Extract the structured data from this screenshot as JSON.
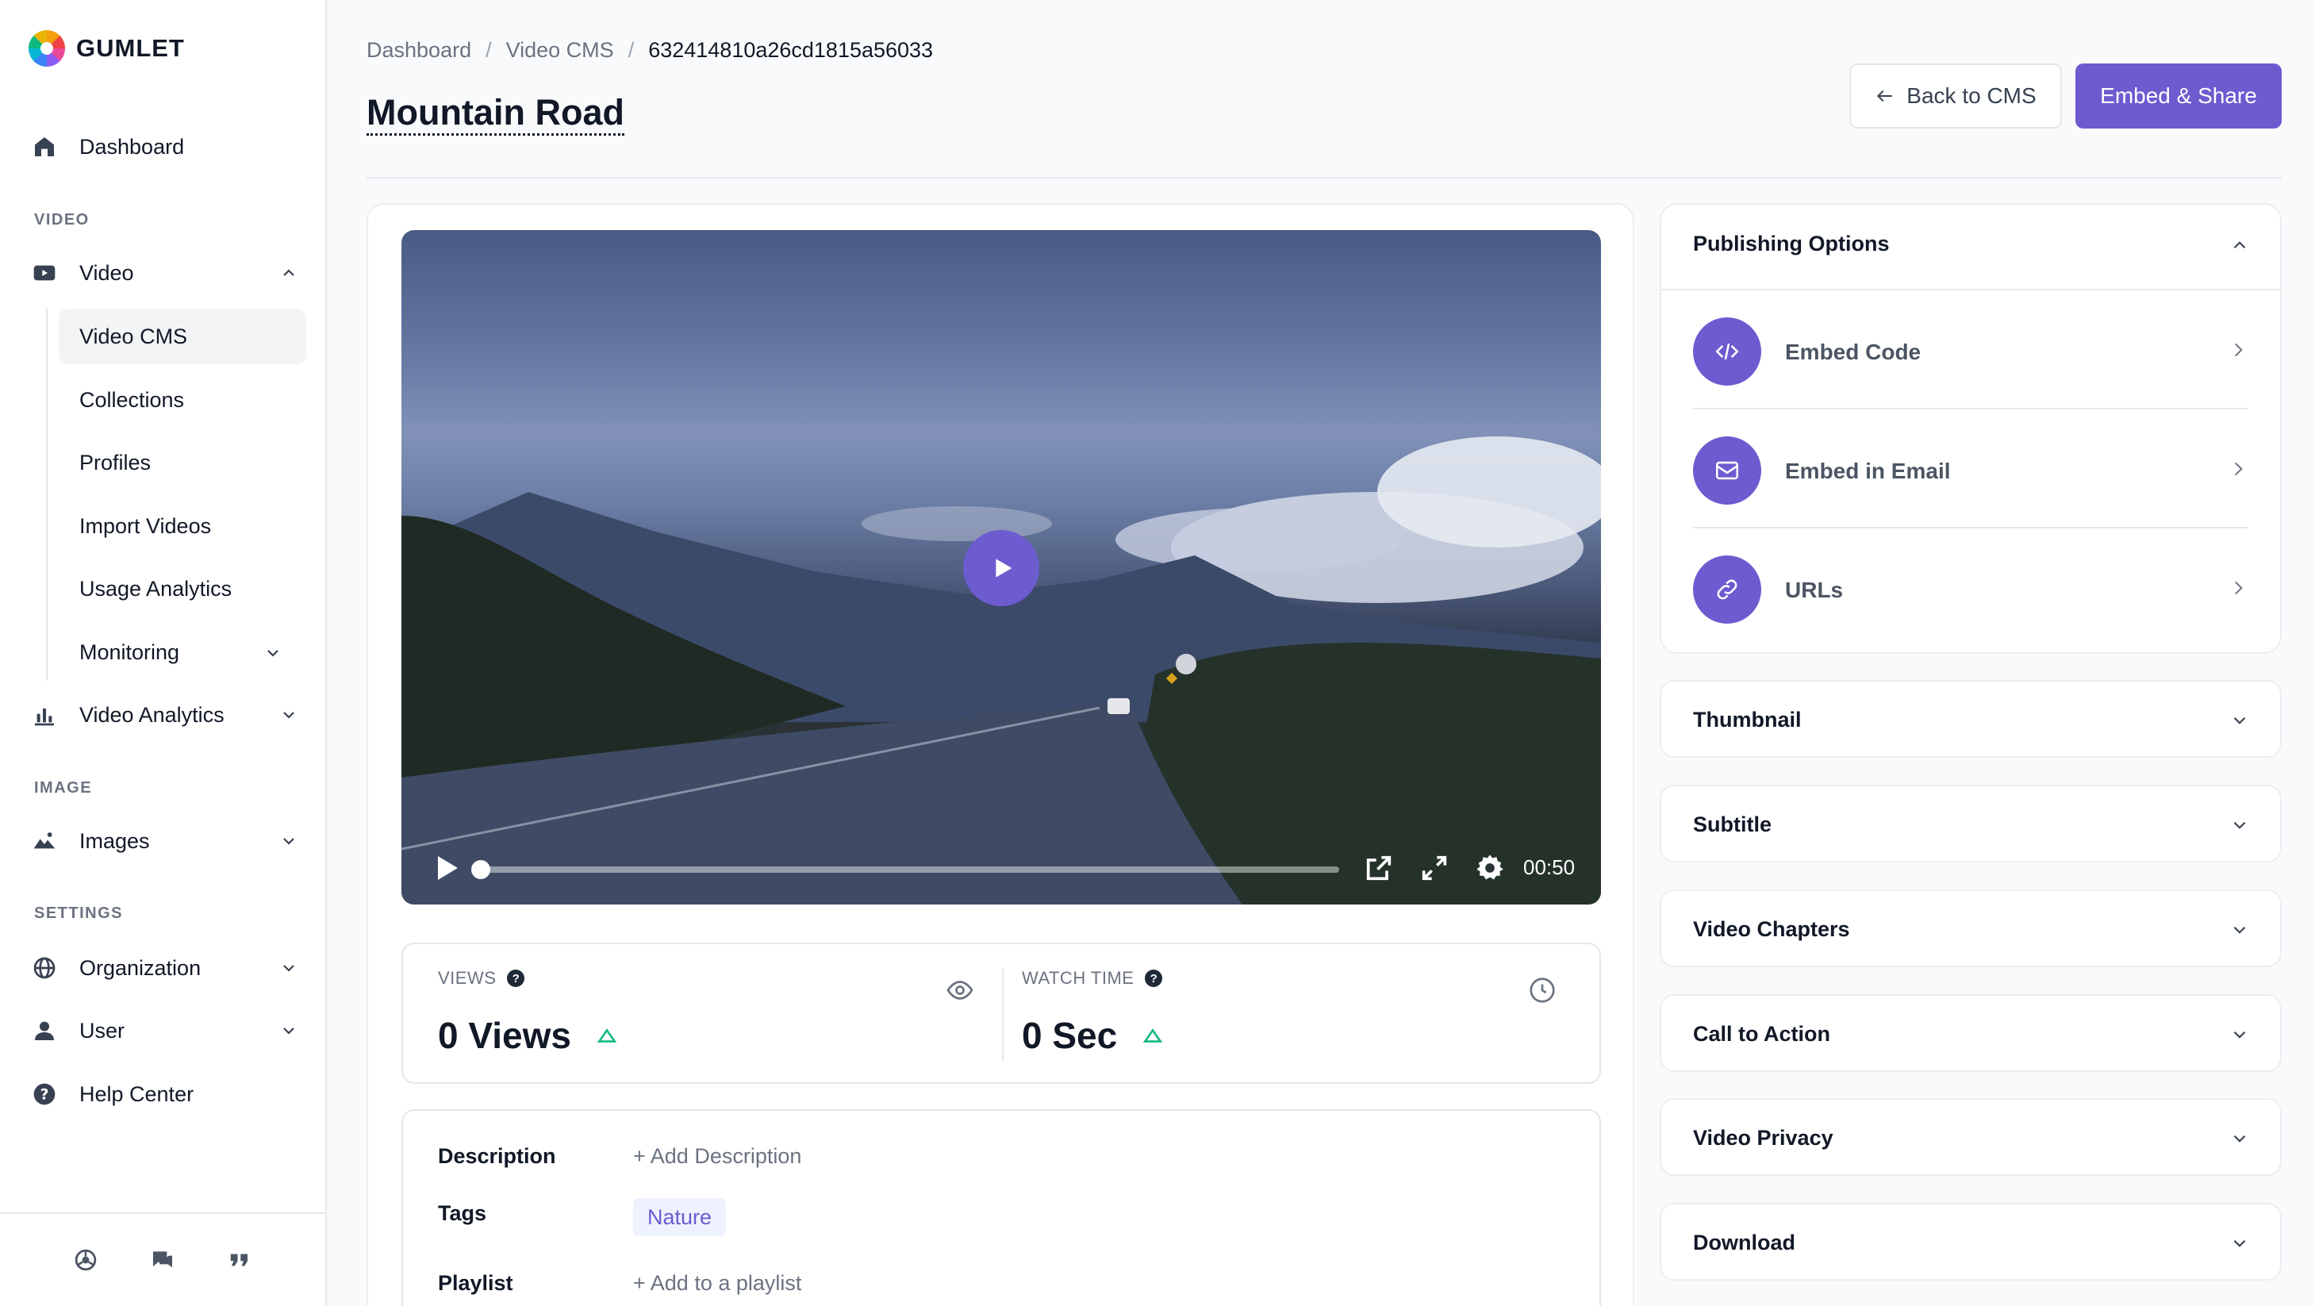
{
  "app": {
    "logo_text": "GUMLET"
  },
  "sidebar": {
    "dashboard": "Dashboard",
    "section_video": "VIDEO",
    "video": "Video",
    "sub_items": [
      "Video CMS",
      "Collections",
      "Profiles",
      "Import Videos",
      "Usage Analytics",
      "Monitoring"
    ],
    "video_analytics": "Video Analytics",
    "section_image": "IMAGE",
    "images": "Images",
    "section_settings": "SETTINGS",
    "organization": "Organization",
    "user": "User",
    "help_center": "Help Center"
  },
  "breadcrumb": {
    "items": [
      "Dashboard",
      "Video CMS",
      "632414810a26cd1815a56033"
    ],
    "separator": "/"
  },
  "page": {
    "title": "Mountain Road"
  },
  "header": {
    "back_label": "Back to CMS",
    "embed_label": "Embed & Share"
  },
  "player": {
    "time": "00:50",
    "progress": 0
  },
  "stats": {
    "views": {
      "label": "VIEWS",
      "value": "0 Views"
    },
    "watch_time": {
      "label": "WATCH TIME",
      "value": "0 Sec"
    }
  },
  "details": {
    "description_label": "Description",
    "description_action": "+ Add Description",
    "tags_label": "Tags",
    "tags": [
      "Nature"
    ],
    "playlist_label": "Playlist",
    "playlist_action": "+ Add to a playlist"
  },
  "publishing": {
    "title": "Publishing Options",
    "items": [
      "Embed Code",
      "Embed in Email",
      "URLs"
    ]
  },
  "accordions": [
    "Thumbnail",
    "Subtitle",
    "Video Chapters",
    "Call to Action",
    "Video Privacy",
    "Download"
  ],
  "colors": {
    "accent": "#6d5bd0",
    "text": "#111827",
    "muted": "#6b7280",
    "border": "#e5e7eb"
  }
}
